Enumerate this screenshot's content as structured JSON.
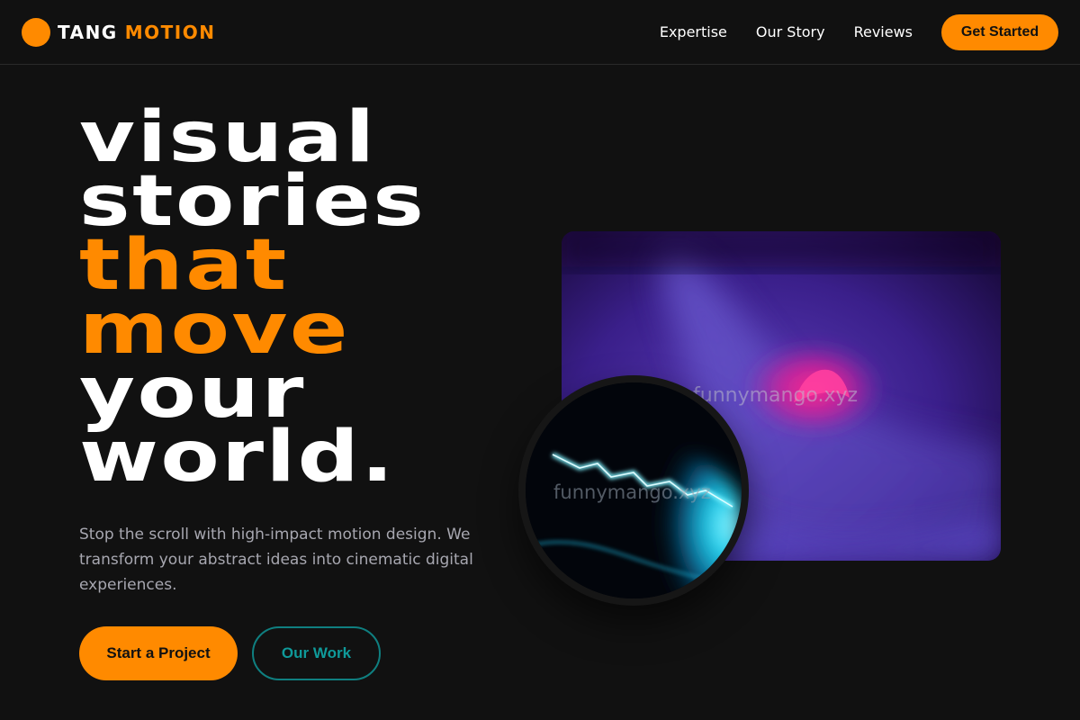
{
  "brand": {
    "name_part1": "TANG",
    "name_part2": "MOTION",
    "logo_icon": "orange-circle-logo",
    "accent_color": "#ff8a00"
  },
  "nav": {
    "links": [
      "Expertise",
      "Our Story",
      "Reviews"
    ],
    "cta_label": "Get Started"
  },
  "hero": {
    "headline": [
      {
        "text": "visual",
        "color": "white"
      },
      {
        "text": "stories",
        "color": "white"
      },
      {
        "text": "that",
        "color": "orange"
      },
      {
        "text": "move",
        "color": "orange"
      },
      {
        "text": "your",
        "color": "white"
      },
      {
        "text": "world.",
        "color": "white"
      }
    ],
    "subtext": "Stop the scroll with high-impact motion design. We transform your abstract ideas into cinematic digital experiences.",
    "primary_button": "Start a Project",
    "secondary_button": "Our Work"
  },
  "visuals": {
    "main_card_watermark": "funnymango.xyz",
    "circle_watermark": "funnymango.xyz"
  },
  "colors": {
    "background": "#111111",
    "accent": "#ff8a00",
    "secondary_outline": "#0f7f80",
    "body_text": "#a7a7b0"
  }
}
